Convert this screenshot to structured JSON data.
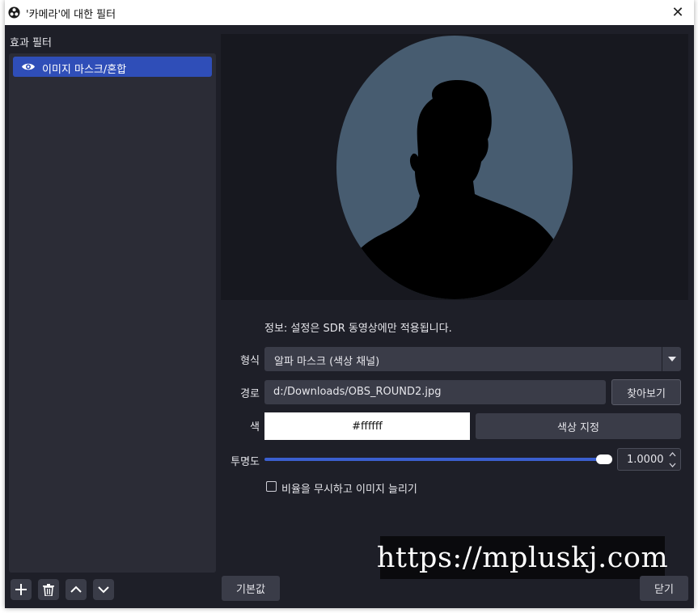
{
  "window": {
    "title": "'카메라'에 대한 필터",
    "close_glyph": "✕",
    "logo_icon": "obs-logo-icon"
  },
  "sidebar": {
    "heading": "효과 필터",
    "filters": [
      {
        "name": "이미지 마스크/혼합",
        "visible": true,
        "selected": true,
        "visibility_icon": "eye-icon"
      }
    ],
    "toolbar": {
      "add_icon": "plus-icon",
      "remove_icon": "trash-icon",
      "move_up_icon": "chevron-up-icon",
      "move_down_icon": "chevron-down-icon"
    }
  },
  "properties": {
    "info": "정보: 설정은 SDR 동영상에만 적용됩니다.",
    "type": {
      "label": "형식",
      "value": "알파 마스크 (색상 채널)"
    },
    "path": {
      "label": "경로",
      "value": "d:/Downloads/OBS_ROUND2.jpg",
      "browse_label": "찾아보기"
    },
    "color": {
      "label": "색",
      "value": "#ffffff",
      "pick_label": "색상 지정"
    },
    "opacity": {
      "label": "투명도",
      "value": "1.0000",
      "level": 1.0
    },
    "stretch": {
      "label": "비율을 무시하고 이미지 늘리기",
      "checked": false
    }
  },
  "watermark": "https://mpluskj.com",
  "footer": {
    "defaults_label": "기본값",
    "close_label": "닫기"
  },
  "colors": {
    "window_bg": "#1e1f28",
    "accent": "#2f4eb8",
    "slider": "#3b5fcf",
    "control_bg": "#3a3c48"
  }
}
